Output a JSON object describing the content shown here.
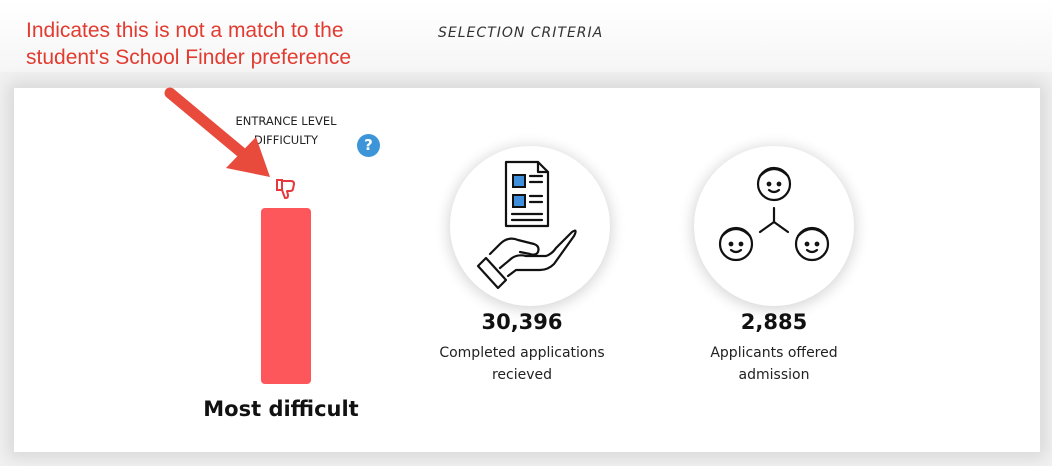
{
  "section": {
    "title": "SELECTION CRITERIA"
  },
  "annotation": {
    "text": "Indicates this is not a match to the student's School Finder preference"
  },
  "entrance_level": {
    "label": "ENTRANCE LEVEL DIFFICULTY",
    "value": "Most difficult",
    "match_icon": "thumbs-down-icon",
    "help_icon": "question-icon",
    "bar_color": "#fd575b"
  },
  "stats": [
    {
      "value": "30,396",
      "label_line1": "Completed applications",
      "label_line2": "recieved",
      "icon": "application-hand-icon"
    },
    {
      "value": "2,885",
      "label_line1": "Applicants offered",
      "label_line2": "admission",
      "icon": "people-network-icon"
    }
  ],
  "colors": {
    "annotation": "#e23b30",
    "help": "#3b95d8",
    "mismatch": "#fd575b"
  }
}
